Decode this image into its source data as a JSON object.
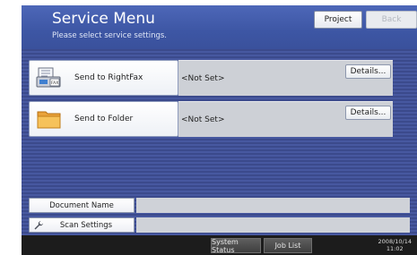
{
  "header": {
    "title": "Service Menu",
    "subtitle": "Please select service settings.",
    "project_label": "Project",
    "back_label": "Back"
  },
  "services": [
    {
      "label": "Send to RightFax",
      "value": "<Not Set>",
      "details_label": "Details...",
      "icon": "fax-icon"
    },
    {
      "label": "Send to Folder",
      "value": "<Not Set>",
      "details_label": "Details...",
      "icon": "folder-icon"
    }
  ],
  "settings": [
    {
      "label": "Document Name",
      "icon": ""
    },
    {
      "label": "Scan Settings",
      "icon": "wrench-icon"
    }
  ],
  "statusbar": {
    "system_status_label": "System Status",
    "job_list_label": "Job List",
    "date": "2008/10/14",
    "time": "11:02"
  },
  "colors": {
    "header_blue": "#3d56a4",
    "content_stripe": "#3b4a8c",
    "field_gray": "#cdd0d6",
    "status_bar": "#1c1c1c"
  }
}
